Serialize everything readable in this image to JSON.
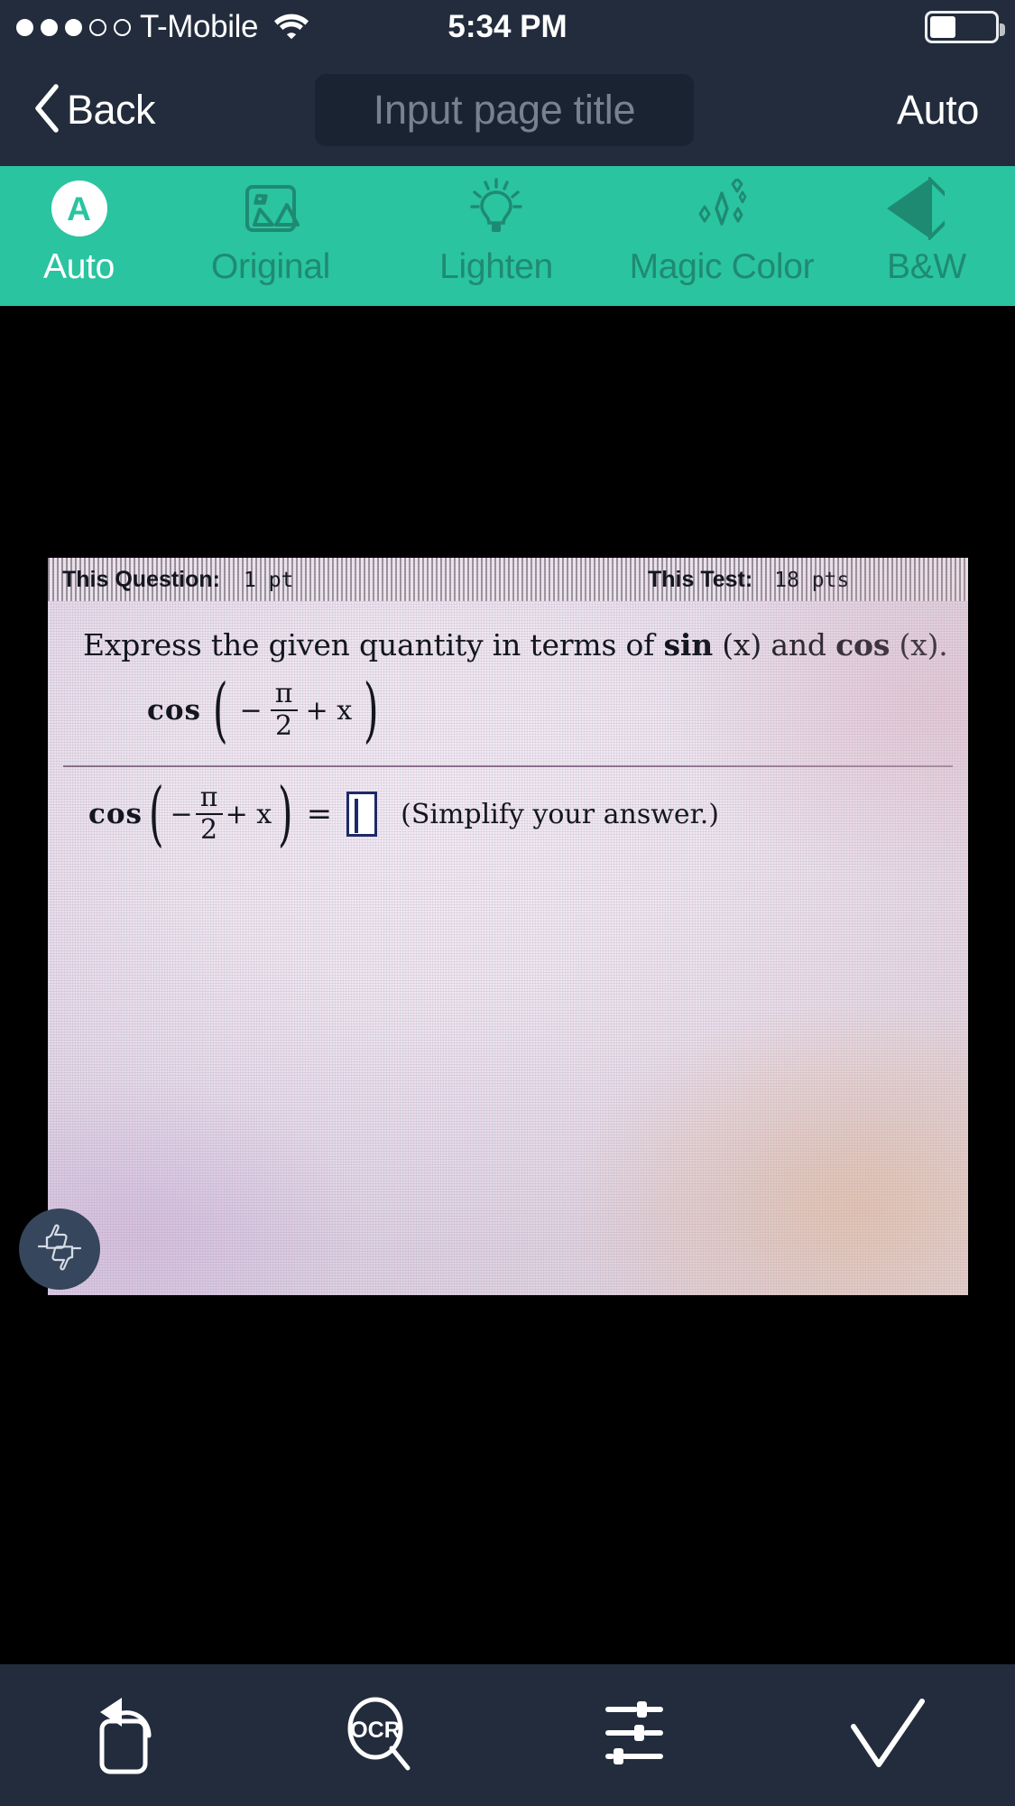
{
  "status_bar": {
    "carrier": "T-Mobile",
    "signal_dots_filled": 3,
    "signal_dots_total": 5,
    "wifi_icon": "wifi-icon",
    "time": "5:34 PM",
    "battery_percent": 40,
    "battery_icon": "battery-icon"
  },
  "nav_bar": {
    "back_label": "Back",
    "back_icon": "chevron-left-icon",
    "title_placeholder": "Input page title",
    "title_value": "",
    "right_label": "Auto"
  },
  "filter_bar": {
    "accent_color": "#2ac4a0",
    "label_color": "#1f8a72",
    "selected_label_color": "#ffffff",
    "selected": "Auto",
    "items": [
      {
        "label": "Auto",
        "icon": "auto-a-circle-icon",
        "badge": "A"
      },
      {
        "label": "Original",
        "icon": "original-image-icon"
      },
      {
        "label": "Lighten",
        "icon": "lightbulb-icon"
      },
      {
        "label": "Magic Color",
        "icon": "sparkles-icon"
      },
      {
        "label": "B&W",
        "icon": "contrast-diamond-icon"
      }
    ]
  },
  "canvas": {
    "background_color": "#000000",
    "scan": {
      "header": {
        "question_label": "This Question:",
        "question_points": "1 pt",
        "test_label": "This Test:",
        "test_points": "18 pts"
      },
      "prompt_pre": "Express the given quantity in terms of ",
      "prompt_fn1": "sin",
      "prompt_arg1": " (x)",
      "prompt_mid": " and ",
      "prompt_fn2": "cos",
      "prompt_arg2": " (x)",
      "prompt_end": ".",
      "expression": {
        "fn": "cos",
        "open_paren": "(",
        "minus": "−",
        "numerator": "π",
        "denominator": "2",
        "plus_x": "+ x",
        "close_paren": ")"
      },
      "answer": {
        "equals": "=",
        "input_value": "",
        "note": "(Simplify your answer.)"
      }
    },
    "feedback_button_icon": "thumbs-up-down-icon"
  },
  "bottom_bar": {
    "items": [
      {
        "name": "rotate-button",
        "icon": "rotate-left-icon"
      },
      {
        "name": "ocr-button",
        "icon": "ocr-magnifier-icon",
        "label": "OCR"
      },
      {
        "name": "adjust-button",
        "icon": "sliders-icon"
      },
      {
        "name": "confirm-button",
        "icon": "checkmark-icon"
      }
    ]
  }
}
